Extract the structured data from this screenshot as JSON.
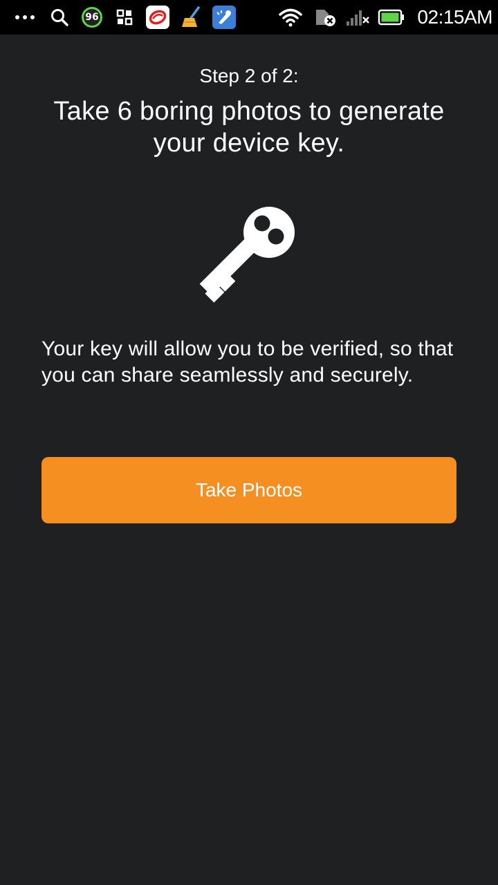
{
  "status_bar": {
    "notification_badge": "96",
    "time": "02:15AM",
    "icons": [
      "overflow-dots-icon",
      "search-icon",
      "score-badge-icon",
      "grid-icon",
      "red-app-icon",
      "broom-cleaner-icon",
      "blue-app-icon",
      "wifi-icon",
      "sim-error-icon",
      "signal-no-service-icon",
      "battery-icon"
    ],
    "colors": {
      "badge_ring": "#5fd34a",
      "battery_fill": "#5fd34a"
    }
  },
  "onboarding": {
    "step": "Step 2 of 2:",
    "headline": "Take 6 boring photos to generate your device key.",
    "illustration_icon": "key-icon",
    "description": "Your key will allow you to be verified, so that you can share seamlessly and securely.",
    "button_label": "Take Photos"
  },
  "colors": {
    "background": "#1f2022",
    "accent": "#f68f21",
    "text": "#ffffff"
  }
}
